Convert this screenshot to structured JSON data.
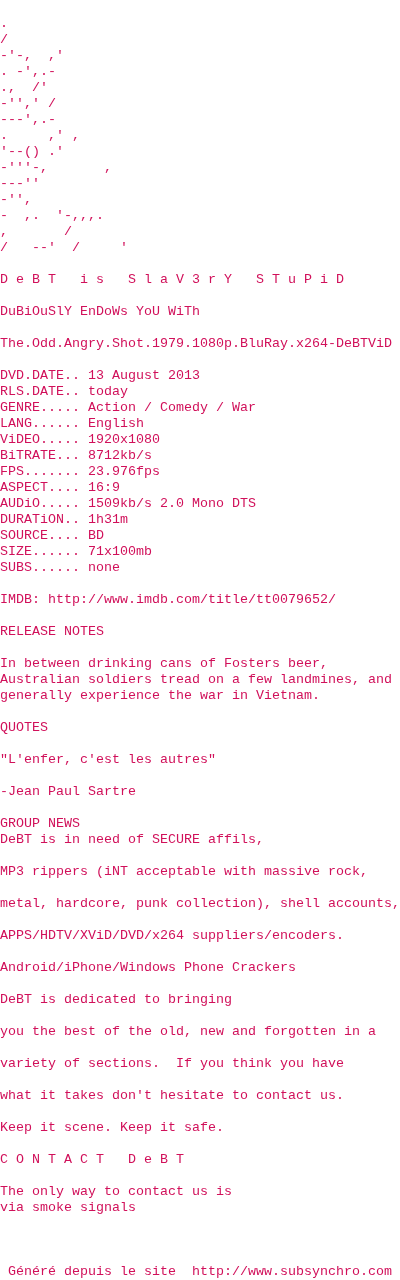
{
  "ascii_art": [
    ".",
    "/",
    "-'-,  ,'",
    ". -',.-",
    ".,  /'",
    "-'',' /",
    "---',.-",
    ".     ,' ,",
    "'--() .'",
    "-'''-,       ,",
    "---''",
    "-'',",
    "-  ,.  '-,,,.",
    ",       /",
    "/   --'  /     '"
  ],
  "blocks": [
    [
      "D e B T   i s   S l a V 3 r Y   S T u P i D"
    ],
    [
      "DuBiOuSlY EnDoWs YoU WiTh"
    ],
    [
      "The.Odd.Angry.Shot.1979.1080p.BluRay.x264-DeBTViD"
    ],
    [
      "DVD.DATE.. 13 August 2013",
      "RLS.DATE.. today",
      "GENRE..... Action / Comedy / War",
      "LANG...... English",
      "ViDEO..... 1920x1080",
      "BiTRATE... 8712kb/s",
      "FPS....... 23.976fps",
      "ASPECT.... 16:9",
      "AUDiO..... 1509kb/s 2.0 Mono DTS",
      "DURATiON.. 1h31m",
      "SOURCE.... BD",
      "SIZE...... 71x100mb",
      "SUBS...... none"
    ],
    [
      "IMDB: http://www.imdb.com/title/tt0079652/"
    ],
    [
      "RELEASE NOTES"
    ],
    [
      "In between drinking cans of Fosters beer,",
      "Australian soldiers tread on a few landmines, and",
      "generally experience the war in Vietnam."
    ],
    [
      "QUOTES"
    ],
    [
      "\"L'enfer, c'est les autres\""
    ],
    [
      "-Jean Paul Sartre"
    ],
    [
      "GROUP NEWS",
      "DeBT is in need of SECURE affils,"
    ],
    [
      "MP3 rippers (iNT acceptable with massive rock,"
    ],
    [
      "metal, hardcore, punk collection), shell accounts,"
    ],
    [
      "APPS/HDTV/XViD/DVD/x264 suppliers/encoders."
    ],
    [
      "Android/iPhone/Windows Phone Crackers"
    ],
    [
      "DeBT is dedicated to bringing"
    ],
    [
      "you the best of the old, new and forgotten in a"
    ],
    [
      "variety of sections.  If you think you have"
    ],
    [
      "what it takes don't hesitate to contact us."
    ],
    [
      "Keep it scene. Keep it safe."
    ],
    [
      "C O N T A C T   D e B T"
    ],
    [
      "The only way to contact us is",
      "via smoke signals"
    ]
  ],
  "footer": "Généré depuis le site  http://www.subsynchro.com"
}
